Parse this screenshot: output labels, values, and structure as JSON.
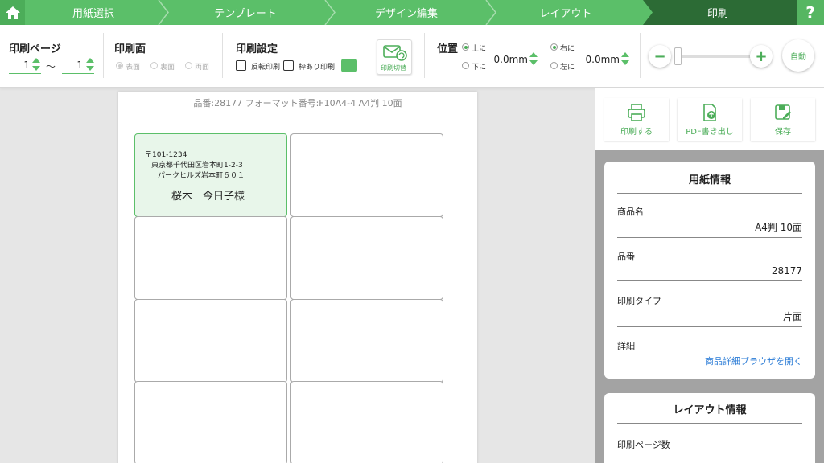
{
  "steps": [
    {
      "label": "用紙選択"
    },
    {
      "label": "テンプレート"
    },
    {
      "label": "デザイン編集"
    },
    {
      "label": "レイアウト"
    },
    {
      "label": "印刷"
    }
  ],
  "help_label": "?",
  "toolbar": {
    "print_page": {
      "label": "印刷ページ",
      "from": "1",
      "tilde": "〜",
      "to": "1"
    },
    "print_side": {
      "label": "印刷面",
      "options": [
        "表面",
        "裏面",
        "両面"
      ],
      "selected": "表面"
    },
    "print_setting": {
      "label": "印刷設定",
      "reverse_label": "反転印刷",
      "frame_label": "枠あり印刷",
      "frame_color": "#5bbf69",
      "switch_label": "印刷切替"
    },
    "position": {
      "label": "位置",
      "vertical_options": [
        "上に",
        "下に"
      ],
      "vertical_selected": "上に",
      "vertical_value": "0.0mm",
      "horizontal_options": [
        "右に",
        "左に"
      ],
      "horizontal_selected": "右に",
      "horizontal_value": "0.0mm"
    },
    "zoom": {
      "minus": "−",
      "plus": "+",
      "auto_label": "自動",
      "level": 0
    }
  },
  "paper": {
    "info": "品番:28177 フォーマット番号:F10A4-4 A4判 10面",
    "label": {
      "postal": "〒101-1234",
      "address1": "東京都千代田区岩本町1-2-3",
      "address2": "パークヒルズ岩本町６０１",
      "name": "桜木　今日子様"
    }
  },
  "actions": [
    {
      "label": "印刷する",
      "icon": "printer-icon"
    },
    {
      "label": "PDF書き出し",
      "icon": "pdf-export-icon"
    },
    {
      "label": "保存",
      "icon": "save-icon"
    }
  ],
  "paper_info_card": {
    "title": "用紙情報",
    "fields": [
      {
        "label": "商品名",
        "value": "A4判 10面"
      },
      {
        "label": "品番",
        "value": "28177"
      },
      {
        "label": "印刷タイプ",
        "value": "片面"
      },
      {
        "label": "詳細",
        "value": "商品詳細ブラウザを開く"
      }
    ]
  },
  "layout_info_card": {
    "title": "レイアウト情報",
    "fields": [
      {
        "label": "印刷ページ数"
      }
    ]
  },
  "colors": {
    "accent": "#5bbf69",
    "accent_dark": "#2c6b35",
    "link": "#2a7bd6"
  }
}
